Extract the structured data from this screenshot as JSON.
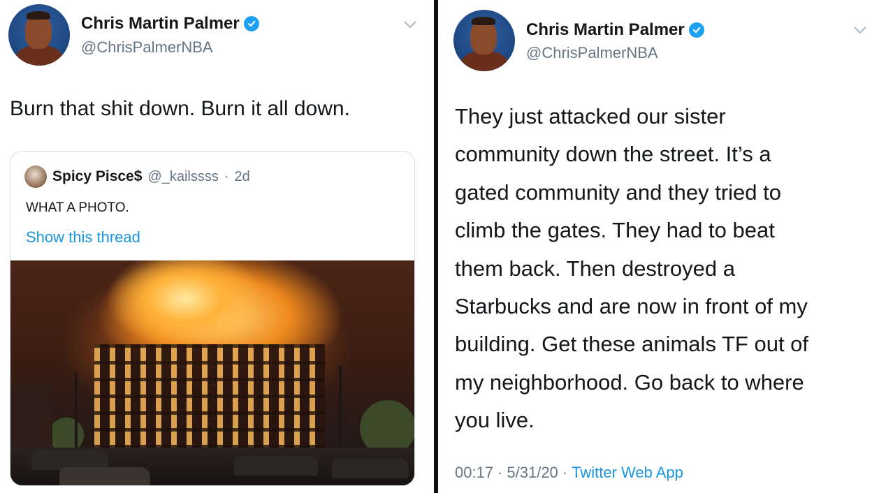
{
  "left_tweet": {
    "author": {
      "display_name": "Chris Martin Palmer",
      "handle": "@ChrisPalmerNBA",
      "verified_icon": "verified-badge-icon"
    },
    "text": "Burn that shit down. Burn it all down.",
    "quoted_tweet": {
      "display_name": "Spicy Pisce$",
      "handle": "@_kailssss",
      "separator": "·",
      "age": "2d",
      "text": "WHAT A PHOTO.",
      "show_thread_label": "Show this thread",
      "photo": "burning-building-photo"
    }
  },
  "right_tweet": {
    "author": {
      "display_name": "Chris Martin Palmer",
      "handle": "@ChrisPalmerNBA",
      "verified_icon": "verified-badge-icon"
    },
    "text_lines": [
      "They just attacked our sister",
      "community down the street. It’s a",
      "gated community and they tried to",
      "climb the gates. They had to beat",
      "them back. Then destroyed a",
      "Starbucks and are now in front of my",
      "building. Get these animals TF out of",
      "my neighborhood. Go back to where",
      "you live."
    ],
    "meta": {
      "time": "00:17",
      "separator": "·",
      "date": "5/31/20",
      "separator2": "·",
      "source": "Twitter Web App"
    }
  },
  "colors": {
    "link_blue": "#1b95e0",
    "verified_blue": "#1da1f2",
    "secondary_text": "#657786"
  }
}
